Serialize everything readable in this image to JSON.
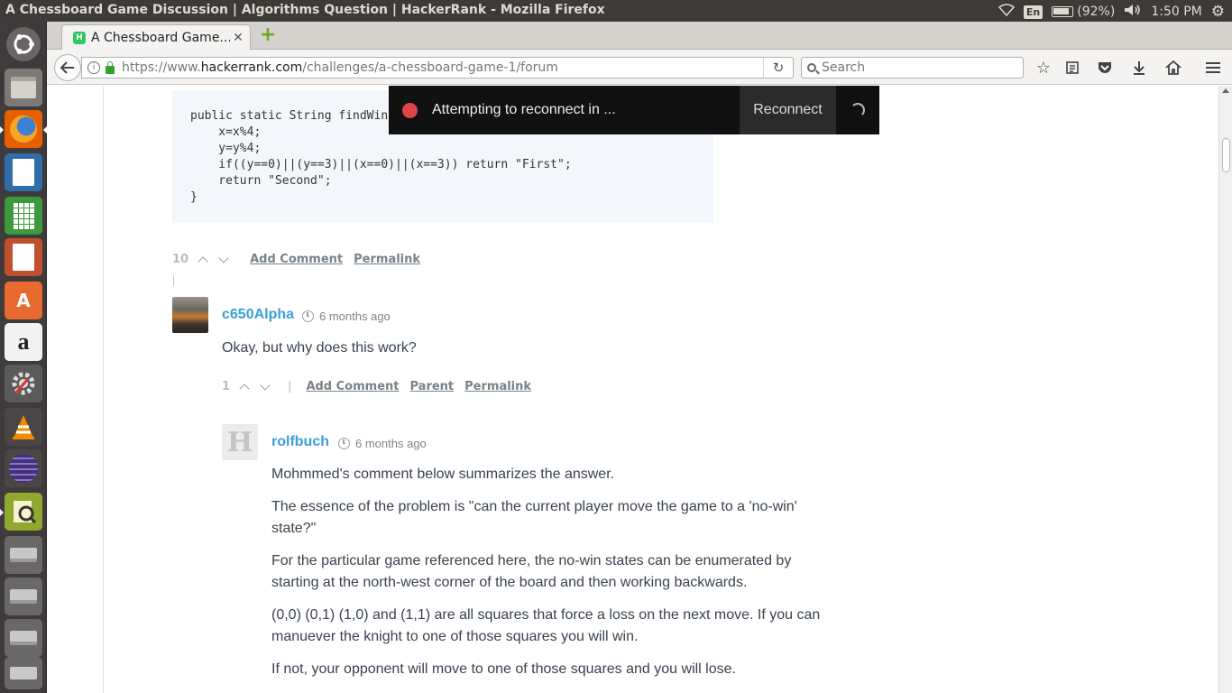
{
  "window": {
    "title": "A Chessboard Game Discussion | Algorithms Question | HackerRank - Mozilla Firefox"
  },
  "tray": {
    "language": "En",
    "battery": "(92%)",
    "time": "1:50 PM"
  },
  "launcher": {
    "apps": [
      "ubuntu-dash-icon",
      "files-icon",
      "firefox-icon",
      "libreoffice-writer-icon",
      "libreoffice-calc-icon",
      "libreoffice-impress-icon",
      "software-center-icon",
      "amazon-icon",
      "system-settings-icon",
      "vlc-icon",
      "eclipse-icon",
      "document-viewer-icon",
      "drive-icon",
      "drive-icon",
      "drive-icon",
      "dvd-icon"
    ],
    "amazon_label": "a",
    "software_label": "A"
  },
  "browser": {
    "tab_title": "A Chessboard Game...",
    "tab_favicon": "H",
    "url_prefix": "https://www.",
    "url_domain": "hackerrank.com",
    "url_path": "/challenges/a-chessboard-game-1/forum",
    "search_placeholder": "Search"
  },
  "code": {
    "text": "public static String findWin\n    x=x%4;\n    y=y%4;\n    if((y==0)||(y==3)||(x==0)||(x==3)) return \"First\";\n    return \"Second\";\n}"
  },
  "post_actions": {
    "votes": "10",
    "add_comment": "Add Comment",
    "permalink": "Permalink"
  },
  "comment1": {
    "username": "c650Alpha",
    "timestamp": "6 months ago",
    "text": "Okay, but why does this work?",
    "votes": "1",
    "separator": "|",
    "add_comment": "Add Comment",
    "parent": "Parent",
    "permalink": "Permalink"
  },
  "comment2": {
    "avatar_letter": "H",
    "username": "rolfbuch",
    "timestamp": "6 months ago",
    "paragraphs": [
      "Mohmmed's comment below summarizes the answer.",
      "The essence of the problem is \"can the current player move the game to a 'no-win' state?\"",
      "For the particular game referenced here, the no-win states can be enumerated by starting at the north-west corner of the board and then working backwards.",
      "(0,0) (0,1) (1,0) and (1,1) are all squares that force a loss on the next move. If you can manuever the knight to one of those squares you will win.",
      "If not, your opponent will move to one of those squares and you will lose."
    ]
  },
  "toast": {
    "message": "Attempting to reconnect in ...",
    "button": "Reconnect"
  },
  "colors": {
    "link": "#39a0d9",
    "toast_dot": "#e04447",
    "favicon": "#2ec866"
  }
}
